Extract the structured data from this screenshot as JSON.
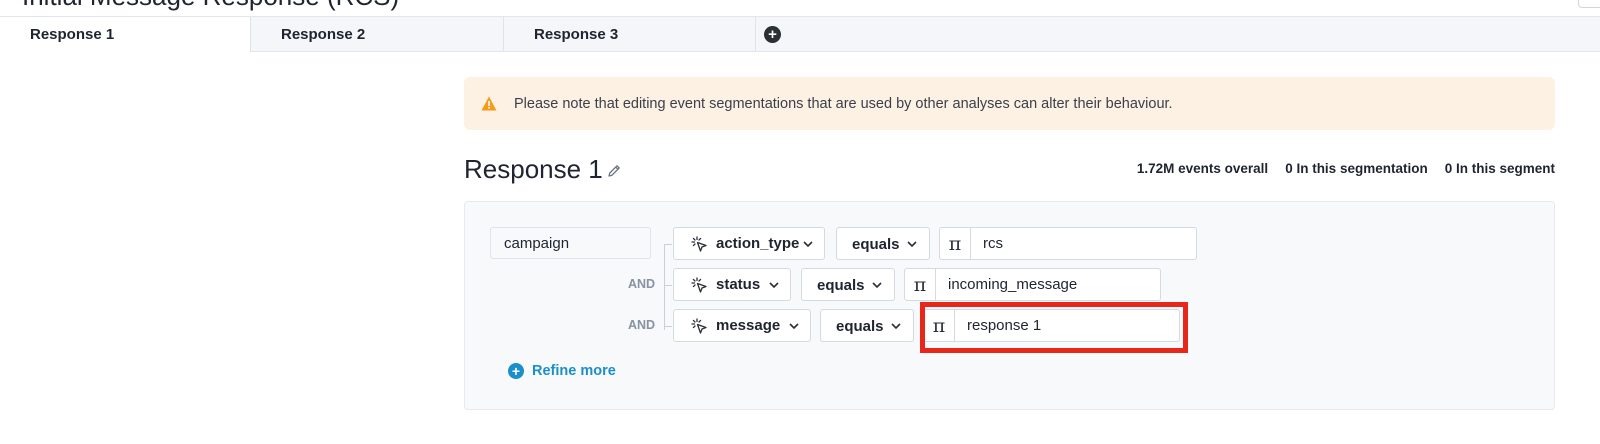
{
  "header": {
    "title": "Initial Message Response (RCS)"
  },
  "tabs": [
    {
      "label": "Response 1",
      "active": true
    },
    {
      "label": "Response 2",
      "active": false
    },
    {
      "label": "Response 3",
      "active": false
    }
  ],
  "tab_add_icon": "plus-circle-icon",
  "banner": {
    "icon": "warning-icon",
    "text": "Please note that editing event segmentations that are used by other analyses can alter their behaviour.",
    "color": "#fdf1e3",
    "icon_color": "#f59b1c"
  },
  "segment": {
    "title": "Response 1",
    "edit_icon": "pencil-icon",
    "stats": {
      "overall": "1.72M events overall",
      "segmentation": "0 In this segmentation",
      "segment": "0 In this segment"
    }
  },
  "filters": {
    "event_property": "campaign",
    "conditions": [
      {
        "connector": "",
        "property": "action_type",
        "operator": "equals",
        "value_type_icon": "text-type-icon",
        "value": "rcs"
      },
      {
        "connector": "AND",
        "property": "status",
        "operator": "equals",
        "value_type_icon": "text-type-icon",
        "value": "incoming_message"
      },
      {
        "connector": "AND",
        "property": "message",
        "operator": "equals",
        "value_type_icon": "text-type-icon",
        "value": "response 1"
      }
    ],
    "refine_label": "Refine more"
  },
  "colors": {
    "accent": "#1a8fc9",
    "highlight": "#e8261a"
  }
}
